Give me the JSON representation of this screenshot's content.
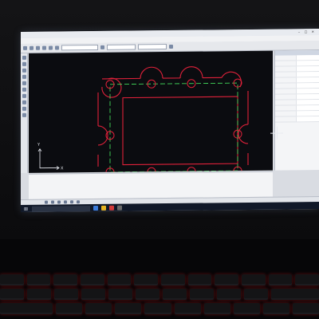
{
  "window": {
    "title": "",
    "controls": "‒ ▢ ✕"
  },
  "menu": {
    "items": [
      "",
      "",
      "",
      "",
      "",
      "",
      "",
      "",
      "",
      "",
      ""
    ]
  },
  "toolbar": {
    "layer_select": "",
    "color_select": "",
    "linetype_select": ""
  },
  "drawing": {
    "ucs_y": "Y",
    "ucs_x": "X"
  },
  "command": {
    "lines": [
      "",
      ""
    ]
  },
  "taskbar": {
    "search_placeholder": "",
    "clock": ""
  },
  "colors": {
    "outline": "#e0213a",
    "centerline": "#41d65a",
    "keyboard_glow": "#ff2d2d"
  }
}
